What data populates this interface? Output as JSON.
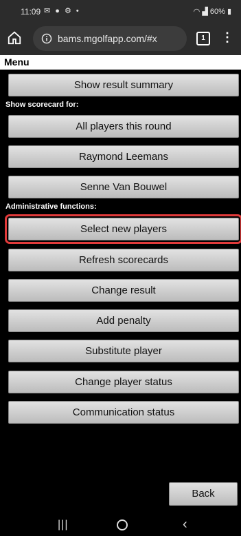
{
  "status_bar": {
    "time": "11:09",
    "notification_icons": "✉ ● ⚙ •",
    "system_status": "60%"
  },
  "browser": {
    "url": "bams.mgolfapp.com/#x",
    "tab_count": "1"
  },
  "menu": {
    "title": "Menu",
    "show_result_summary": "Show result summary",
    "scorecard_label": "Show scorecard for:",
    "scorecard_buttons": [
      "All players this round",
      "Raymond Leemans",
      "Senne Van Bouwel"
    ],
    "admin_label": "Administrative functions:",
    "admin_buttons": [
      "Select new players",
      "Refresh scorecards",
      "Change result",
      "Add penalty",
      "Substitute player",
      "Change player status",
      "Communication status"
    ],
    "back_label": "Back"
  },
  "colors": {
    "highlight": "#e13a3a",
    "background": "#000000",
    "button": "#d0d0d0"
  }
}
